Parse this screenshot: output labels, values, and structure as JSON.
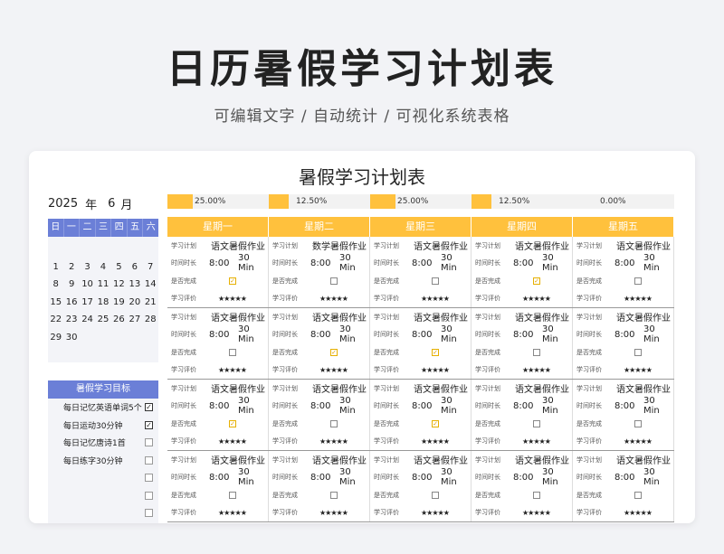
{
  "page": {
    "title": "日历暑假学习计划表",
    "subtitle": "可编辑文字 / 自动统计 / 可视化系统表格"
  },
  "sheet": {
    "title": "暑假学习计划表",
    "year": "2025",
    "year_unit": "年",
    "month": "6",
    "month_unit": "月"
  },
  "calendar": {
    "weekdays": [
      "日",
      "一",
      "二",
      "三",
      "四",
      "五",
      "六"
    ],
    "rows": [
      [
        "1",
        "2",
        "3",
        "4",
        "5",
        "6",
        "7"
      ],
      [
        "8",
        "9",
        "10",
        "11",
        "12",
        "13",
        "14"
      ],
      [
        "15",
        "16",
        "17",
        "18",
        "19",
        "20",
        "21"
      ],
      [
        "22",
        "23",
        "24",
        "25",
        "26",
        "27",
        "28"
      ],
      [
        "29",
        "30",
        "",
        "",
        "",
        "",
        ""
      ]
    ]
  },
  "goals": {
    "title": "暑假学习目标",
    "items": [
      {
        "label": "每日记忆英语单词5个",
        "checked": true
      },
      {
        "label": "每日运动30分钟",
        "checked": true
      },
      {
        "label": "每日记忆唐诗1首",
        "checked": false
      },
      {
        "label": "每日练字30分钟",
        "checked": false
      },
      {
        "label": "",
        "checked": false
      },
      {
        "label": "",
        "checked": false
      },
      {
        "label": "",
        "checked": false
      }
    ]
  },
  "progress": [
    {
      "label": "25.00%",
      "value": 0.25
    },
    {
      "label": "12.50%",
      "value": 0.125
    },
    {
      "label": "25.00%",
      "value": 0.25
    },
    {
      "label": "12.50%",
      "value": 0.125
    },
    {
      "label": "0.00%",
      "value": 0.0
    }
  ],
  "days": [
    "星期一",
    "星期二",
    "星期三",
    "星期四",
    "星期五"
  ],
  "labels": {
    "plan": "学习计划",
    "duration": "时间时长",
    "done": "是否完成",
    "eval": "学习评价",
    "min": "Min",
    "stars": "★★★★★",
    "check_on": "☑",
    "check_off": "☐"
  },
  "weeks": [
    [
      {
        "plan": "语文暑假作业",
        "time": "8:00",
        "minutes": "30",
        "done": true
      },
      {
        "plan": "数学暑假作业",
        "time": "8:00",
        "minutes": "30",
        "done": false
      },
      {
        "plan": "语文暑假作业",
        "time": "8:00",
        "minutes": "30",
        "done": false
      },
      {
        "plan": "语文暑假作业",
        "time": "8:00",
        "minutes": "30",
        "done": true
      },
      {
        "plan": "语文暑假作业",
        "time": "8:00",
        "minutes": "30",
        "done": false
      }
    ],
    [
      {
        "plan": "语文暑假作业",
        "time": "8:00",
        "minutes": "30",
        "done": false
      },
      {
        "plan": "语文暑假作业",
        "time": "8:00",
        "minutes": "30",
        "done": true
      },
      {
        "plan": "语文暑假作业",
        "time": "8:00",
        "minutes": "30",
        "done": true
      },
      {
        "plan": "语文暑假作业",
        "time": "8:00",
        "minutes": "30",
        "done": false
      },
      {
        "plan": "语文暑假作业",
        "time": "8:00",
        "minutes": "30",
        "done": false
      }
    ],
    [
      {
        "plan": "语文暑假作业",
        "time": "8:00",
        "minutes": "30",
        "done": true
      },
      {
        "plan": "语文暑假作业",
        "time": "8:00",
        "minutes": "30",
        "done": false
      },
      {
        "plan": "语文暑假作业",
        "time": "8:00",
        "minutes": "30",
        "done": true
      },
      {
        "plan": "语文暑假作业",
        "time": "8:00",
        "minutes": "30",
        "done": false
      },
      {
        "plan": "语文暑假作业",
        "time": "8:00",
        "minutes": "30",
        "done": false
      }
    ],
    [
      {
        "plan": "语文暑假作业",
        "time": "8:00",
        "minutes": "30",
        "done": false
      },
      {
        "plan": "语文暑假作业",
        "time": "8:00",
        "minutes": "30",
        "done": false
      },
      {
        "plan": "语文暑假作业",
        "time": "8:00",
        "minutes": "30",
        "done": false
      },
      {
        "plan": "语文暑假作业",
        "time": "8:00",
        "minutes": "30",
        "done": false
      },
      {
        "plan": "语文暑假作业",
        "time": "8:00",
        "minutes": "30",
        "done": false
      }
    ]
  ]
}
